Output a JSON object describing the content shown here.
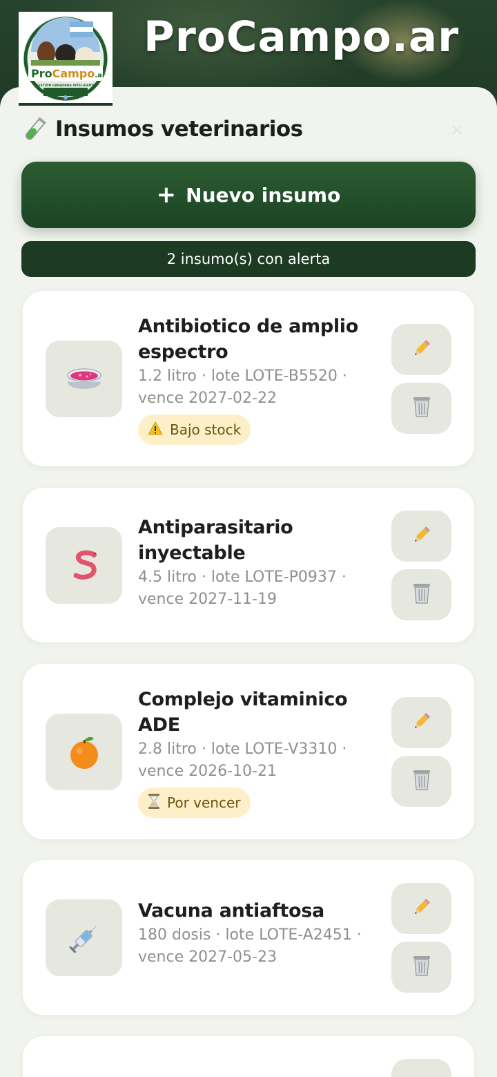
{
  "app": {
    "title": "ProCampo.ar"
  },
  "logo": {
    "brand_pro": "Pro",
    "brand_campo": "Campo",
    "brand_suffix": ".ar",
    "tagline": "GESTIÓN GANADERA INTELIGENTE"
  },
  "sheet": {
    "title": "Insumos veterinarios",
    "title_icon": "test-tube-icon",
    "close_label": "×"
  },
  "new_button": {
    "plus": "+",
    "label": "Nuevo insumo"
  },
  "alert_bar": {
    "text": "2 insumo(s) con alerta"
  },
  "colors": {
    "brand_green": "#1d3a22",
    "button_green": "#2c5c33",
    "badge_bg": "#fdf0c8",
    "badge_text": "#6b5410",
    "muted_text": "#8e918b"
  },
  "supplies": [
    {
      "icon": "petri-dish-icon",
      "name_line1": "Antibiotico de amplio",
      "name_line2": "espectro",
      "meta_line1": "1.2 litro · lote LOTE-B5520 ·",
      "meta_line2": "vence 2027-02-22",
      "badge": {
        "icon": "warning-icon",
        "label": "Bajo stock"
      }
    },
    {
      "icon": "worm-icon",
      "name_line1": "Antiparasitario",
      "name_line2": "inyectable",
      "meta_line1": "4.5 litro · lote LOTE-P0937 ·",
      "meta_line2": "vence 2027-11-19"
    },
    {
      "icon": "orange-icon",
      "name_line1": "Complejo vitaminico",
      "name_line2": "ADE",
      "meta_line1": "2.8 litro · lote LOTE-V3310 ·",
      "meta_line2": "vence 2026-10-21",
      "badge": {
        "icon": "hourglass-icon",
        "label": "Por vencer"
      }
    },
    {
      "icon": "syringe-icon",
      "name_line1": "Vacuna antiaftosa",
      "meta_line1": "180 dosis · lote LOTE-A2451 ·",
      "meta_line2": "vence 2027-05-23"
    }
  ],
  "actions": {
    "edit_icon": "pencil-icon",
    "delete_icon": "wastebasket-icon"
  }
}
